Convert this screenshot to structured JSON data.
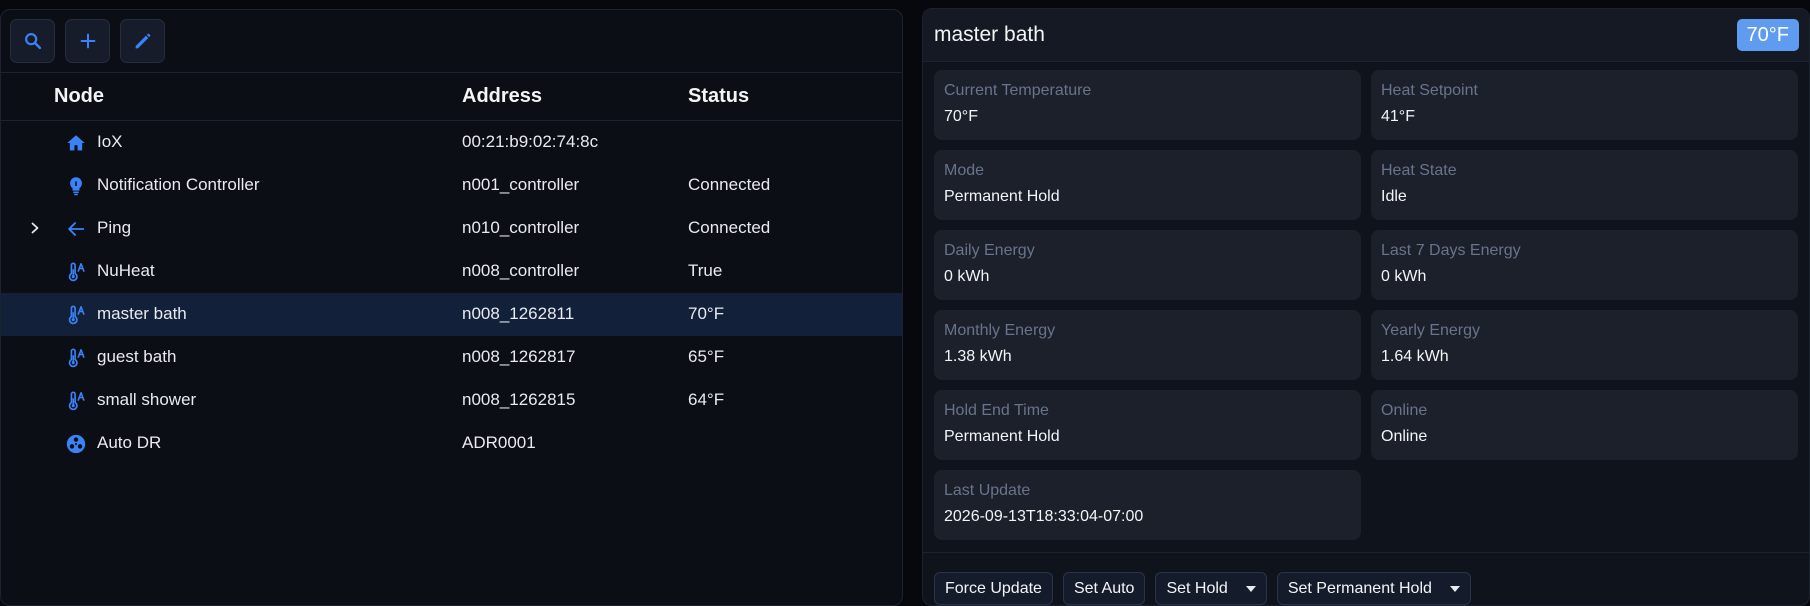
{
  "toolbar": {
    "buttons": [
      {
        "icon": "search-icon"
      },
      {
        "icon": "plus-icon"
      },
      {
        "icon": "pencil-icon"
      }
    ]
  },
  "table": {
    "headers": {
      "node": "Node",
      "address": "Address",
      "status": "Status"
    },
    "rows": [
      {
        "name": "IoX",
        "address": "00:21:b9:02:74:8c",
        "status": "",
        "icon": "home-icon"
      },
      {
        "name": "Notification Controller",
        "address": "n001_controller",
        "status": "Connected",
        "icon": "lightbulb-icon"
      },
      {
        "name": "Ping",
        "address": "n010_controller",
        "status": "Connected",
        "icon": "arrow-left-icon"
      },
      {
        "name": "NuHeat",
        "address": "n008_controller",
        "status": "True",
        "icon": "thermostat-icon"
      },
      {
        "name": "master bath",
        "address": "n008_1262811",
        "status": "70°F",
        "icon": "thermostat-icon"
      },
      {
        "name": "guest bath",
        "address": "n008_1262817",
        "status": "65°F",
        "icon": "thermostat-icon"
      },
      {
        "name": "small shower",
        "address": "n008_1262815",
        "status": "64°F",
        "icon": "thermostat-icon"
      },
      {
        "name": "Auto DR",
        "address": "ADR0001",
        "status": "",
        "icon": "auto-dr-icon"
      }
    ]
  },
  "detail": {
    "title": "master bath",
    "badge": "70°F",
    "properties": [
      {
        "label": "Current Temperature",
        "value": "70°F"
      },
      {
        "label": "Heat Setpoint",
        "value": "41°F"
      },
      {
        "label": "Mode",
        "value": "Permanent Hold"
      },
      {
        "label": "Heat State",
        "value": "Idle"
      },
      {
        "label": "Daily Energy",
        "value": "0 kWh"
      },
      {
        "label": "Last 7 Days Energy",
        "value": "0 kWh"
      },
      {
        "label": "Monthly Energy",
        "value": "1.38 kWh"
      },
      {
        "label": "Yearly Energy",
        "value": "1.64 kWh"
      },
      {
        "label": "Hold End Time",
        "value": "Permanent Hold"
      },
      {
        "label": "Online",
        "value": "Online"
      },
      {
        "label": "Last Update",
        "value": "2026-09-13T18:33:04-07:00"
      }
    ],
    "actions": [
      {
        "label": "Force Update"
      },
      {
        "label": "Set Auto"
      },
      {
        "label": "Set Hold"
      },
      {
        "label": "Set Permanent Hold"
      }
    ]
  },
  "colors": {
    "accent": "#3b82f6",
    "badge": "#5f9cf0",
    "selected_row": "#12203a"
  }
}
